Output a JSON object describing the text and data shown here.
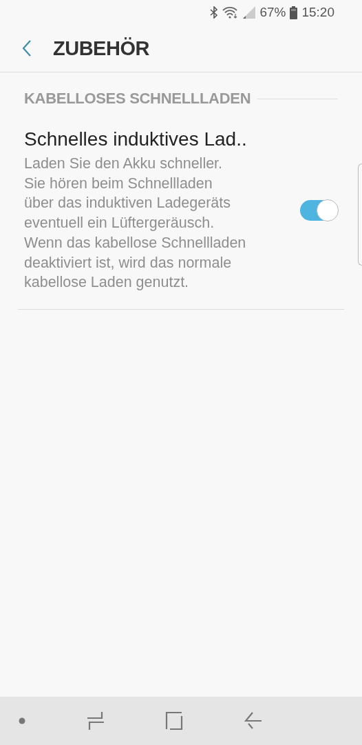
{
  "status_bar": {
    "battery": "67%",
    "time": "15:20"
  },
  "header": {
    "title": "ZUBEHÖR"
  },
  "sections": [
    {
      "title": "KABELLOSES SCHNELLLADEN",
      "items": [
        {
          "title": "Schnelles induktives Lad..",
          "description": "Laden Sie den Akku schneller.\nSie hören beim Schnellladen\nüber das induktiven Ladegeräts\neventuell ein Lüftergeräusch.\nWenn das kabellose Schnellladen\ndeaktiviert ist, wird das normale\nkabellose Laden genutzt.",
          "on": true
        }
      ]
    }
  ]
}
